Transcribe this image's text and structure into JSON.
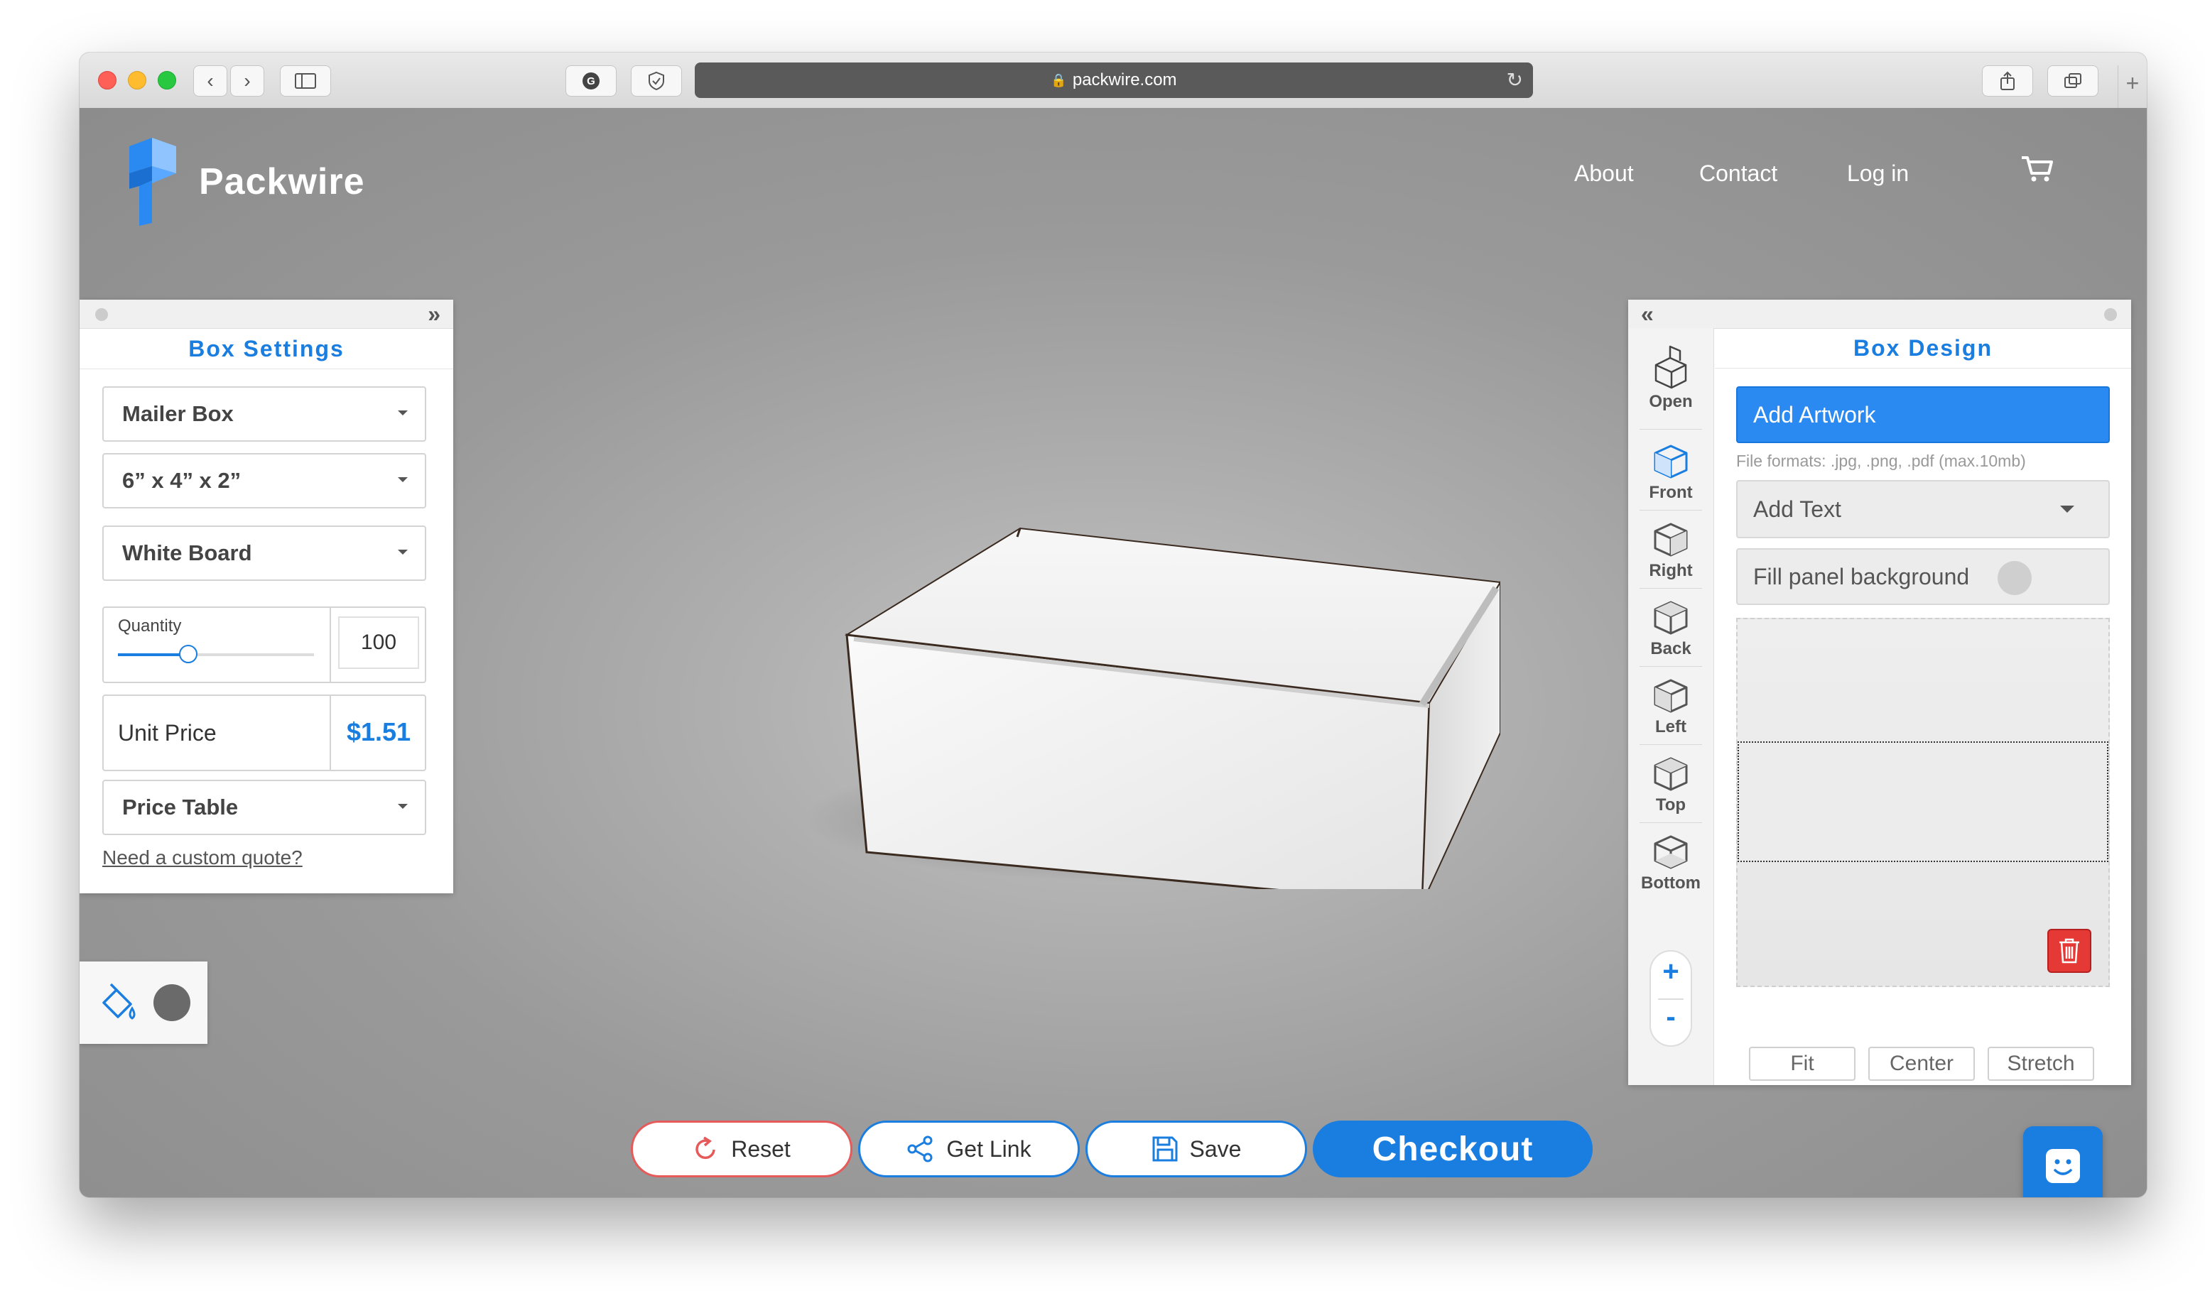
{
  "browser": {
    "url": "packwire.com"
  },
  "header": {
    "brand": "Packwire",
    "nav": [
      {
        "label": "About"
      },
      {
        "label": "Contact"
      },
      {
        "label": "Log in"
      }
    ],
    "cart_icon": "cart-icon"
  },
  "box_settings": {
    "title": "Box Settings",
    "box_type": "Mailer Box",
    "dimensions": "6” x 4” x 2”",
    "material": "White Board",
    "quantity_label": "Quantity",
    "quantity_value": "100",
    "quantity_slider_fraction": 0.36,
    "unit_price_label": "Unit Price",
    "unit_price_value": "$1.51",
    "price_table": "Price Table",
    "custom_quote_link": "Need a custom quote?"
  },
  "color_tool": {
    "icon": "paint-bucket-icon",
    "swatch_color": "#6a6a6a"
  },
  "box_design": {
    "title": "Box Design",
    "views": [
      {
        "label": "Open"
      },
      {
        "label": "Front"
      },
      {
        "label": "Right"
      },
      {
        "label": "Back"
      },
      {
        "label": "Left"
      },
      {
        "label": "Top"
      },
      {
        "label": "Bottom"
      }
    ],
    "zoom_in": "+",
    "zoom_out": "-",
    "add_artwork": "Add Artwork",
    "file_formats": "File formats: .jpg, .png, .pdf (max.10mb)",
    "add_text": "Add Text",
    "fill_panel": "Fill panel background",
    "fit_buttons": [
      "Fit",
      "Center",
      "Stretch"
    ]
  },
  "actions": {
    "reset": "Reset",
    "get_link": "Get Link",
    "save": "Save",
    "checkout": "Checkout"
  },
  "colors": {
    "accent": "#1a7de0",
    "reset_border": "#e65a5a",
    "delete": "#e53935"
  }
}
